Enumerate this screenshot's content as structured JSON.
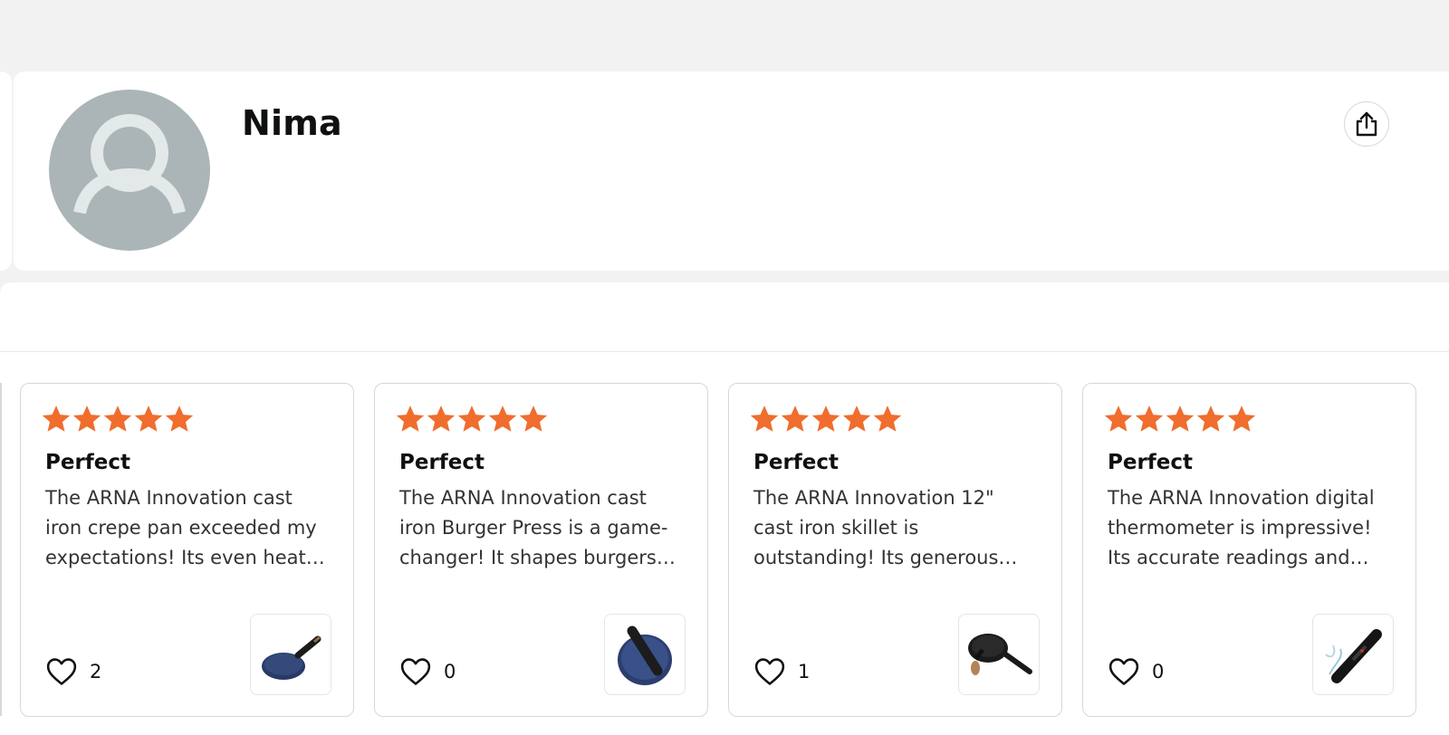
{
  "profile": {
    "name": "Nima",
    "avatar_icon": "person-silhouette-icon",
    "share_icon": "share-icon"
  },
  "colors": {
    "star": "#f06d2d",
    "avatar_bg": "#abb5b7",
    "card_border": "#d5d9d9"
  },
  "reviews": [
    {
      "rating": 5,
      "title": "Perfect",
      "text": "The ARNA Innovation cast iron crepe pan exceeded my expectations! Its even heat…",
      "likes": "2",
      "product_icon": "crepe-pan-icon"
    },
    {
      "rating": 5,
      "title": "Perfect",
      "text": "The ARNA Innovation cast iron Burger Press is a game-changer! It shapes burgers…",
      "likes": "0",
      "product_icon": "burger-press-icon"
    },
    {
      "rating": 5,
      "title": "Perfect",
      "text": "The ARNA Innovation 12\" cast iron skillet is outstanding! Its generous…",
      "likes": "1",
      "product_icon": "skillet-icon"
    },
    {
      "rating": 5,
      "title": "Perfect",
      "text": "The ARNA Innovation digital thermometer is impressive! Its accurate readings and…",
      "likes": "0",
      "product_icon": "thermometer-icon"
    }
  ]
}
